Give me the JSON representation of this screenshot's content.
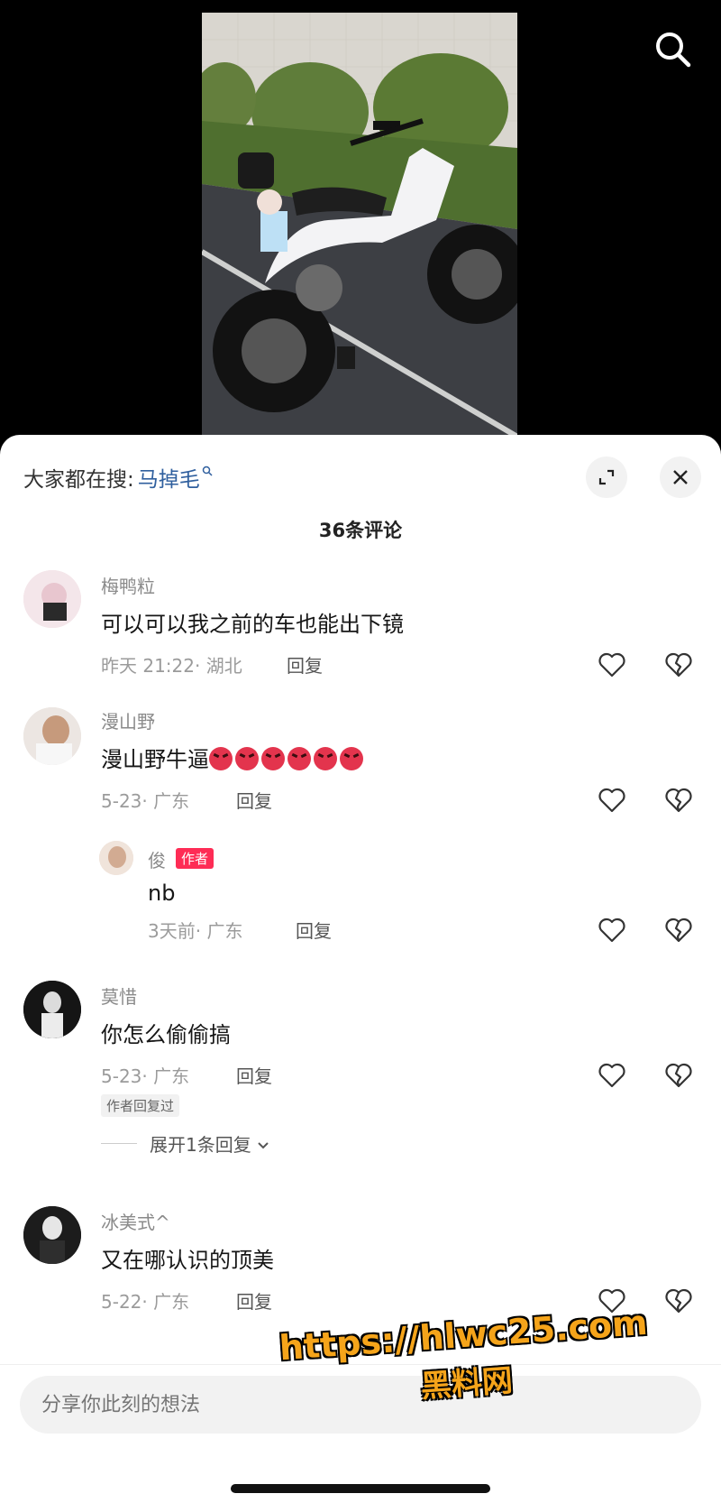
{
  "search_bar": {
    "prefix": "大家都在搜:",
    "keyword": "马掉毛"
  },
  "comment_count": "36条评论",
  "comments": [
    {
      "user": "梅鸭粒",
      "text": "可以可以我之前的车也能出下镜",
      "time": "昨天 21:22",
      "location": "湖北",
      "reply_label": "回复"
    },
    {
      "user": "漫山野",
      "text": "漫山野牛逼",
      "emoji_count": 6,
      "time": "5-23",
      "location": "广东",
      "reply_label": "回复",
      "replies": [
        {
          "user": "俊",
          "badge": "作者",
          "text": "nb",
          "time": "3天前",
          "location": "广东",
          "reply_label": "回复"
        }
      ]
    },
    {
      "user": "莫惜",
      "text": "你怎么偷偷搞",
      "time": "5-23",
      "location": "广东",
      "reply_label": "回复",
      "tag": "作者回复过",
      "expand": "展开1条回复"
    },
    {
      "user": "冰美式^",
      "text": "又在哪认识的顶美",
      "time": "5-22",
      "location": "广东",
      "reply_label": "回复"
    }
  ],
  "input": {
    "placeholder": "分享你此刻的想法"
  },
  "watermark": {
    "line1": "https://hlwc25.com",
    "line2": "黑料网"
  },
  "colors": {
    "accent": "#fe2c55",
    "keyword": "#2f5f9e"
  },
  "icons": [
    "search-icon",
    "expand-icon",
    "close-icon",
    "heart-icon",
    "broken-heart-icon",
    "chevron-down-icon"
  ]
}
